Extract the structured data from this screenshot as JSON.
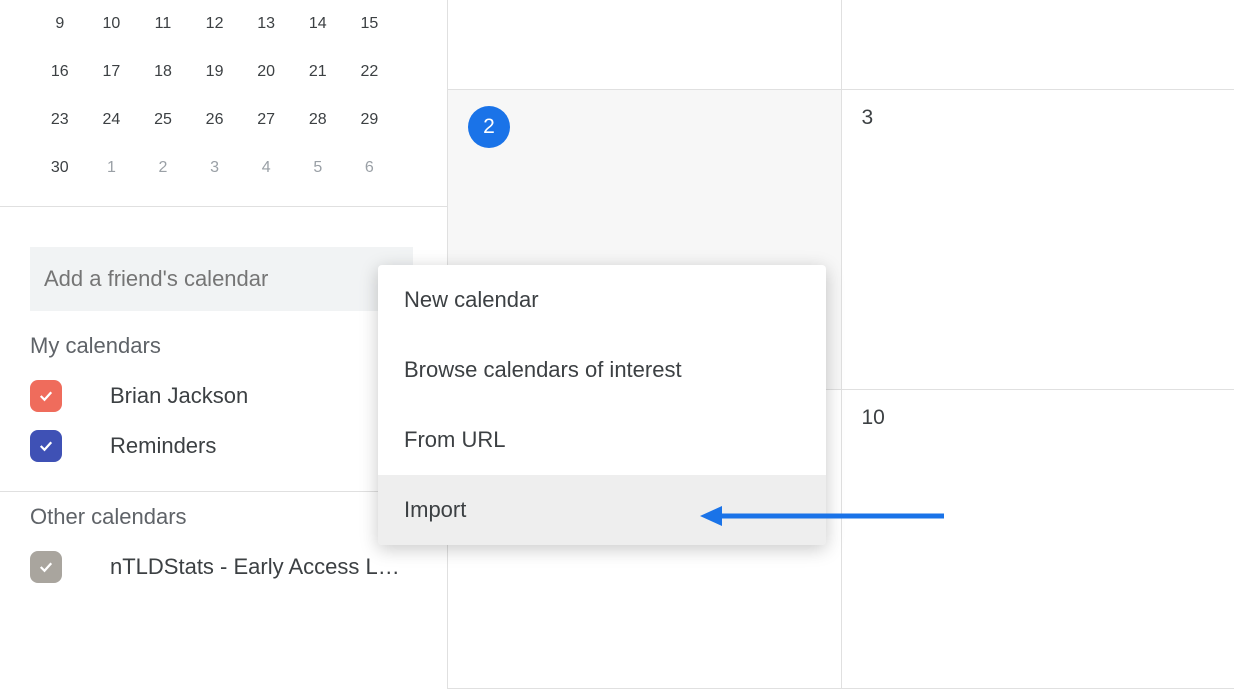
{
  "mini_calendar": {
    "rows": [
      [
        "9",
        "10",
        "11",
        "12",
        "13",
        "14",
        "15"
      ],
      [
        "16",
        "17",
        "18",
        "19",
        "20",
        "21",
        "22"
      ],
      [
        "23",
        "24",
        "25",
        "26",
        "27",
        "28",
        "29"
      ],
      [
        "30",
        "1",
        "2",
        "3",
        "4",
        "5",
        "6"
      ]
    ],
    "dim_last_row_from_index": 1
  },
  "add_friend_placeholder": "Add a friend's calendar",
  "section_my_calendars": "My calendars",
  "section_other_calendars": "Other calendars",
  "my_calendars": [
    {
      "label": "Brian Jackson"
    },
    {
      "label": "Reminders"
    }
  ],
  "other_calendars": [
    {
      "label": "nTLDStats - Early Access L…"
    }
  ],
  "menu": {
    "items": [
      "New calendar",
      "Browse calendars of interest",
      "From URL",
      "Import"
    ],
    "highlight_index": 3
  },
  "week": {
    "col0_day1": "2",
    "col1_day1": "3",
    "col1_day2": "10"
  }
}
